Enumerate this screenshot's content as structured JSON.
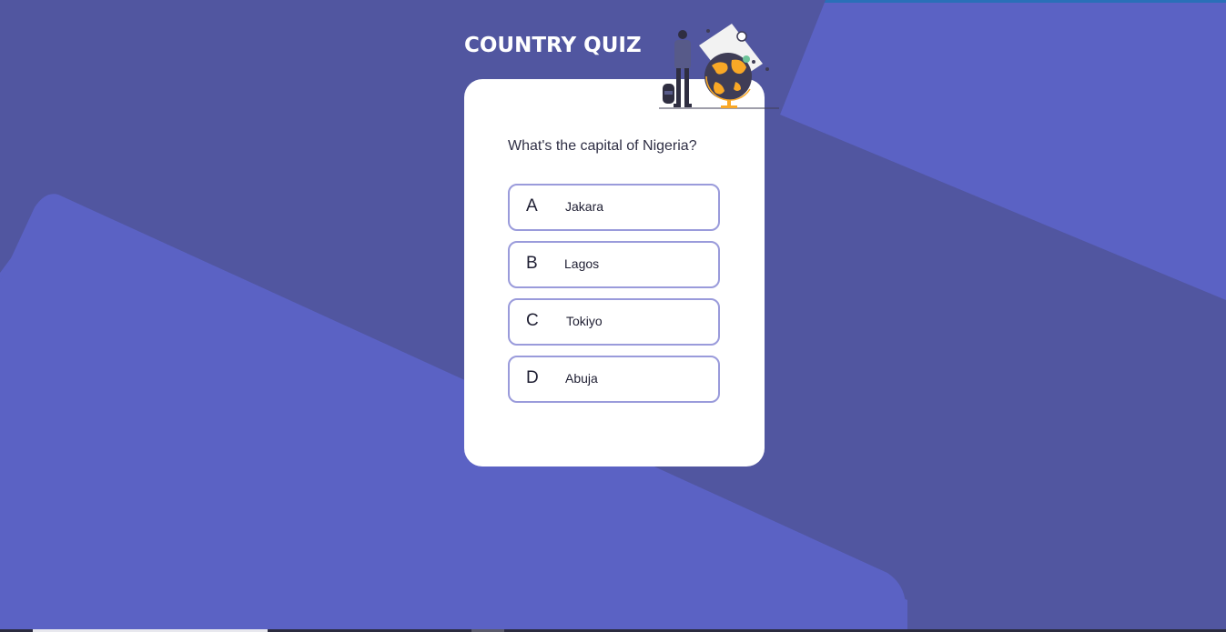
{
  "app": {
    "title": "COUNTRY QUIZ"
  },
  "quiz": {
    "question": "What's the capital of Nigeria?",
    "options": [
      {
        "letter": "A",
        "text": "Jakara"
      },
      {
        "letter": "B",
        "text": "Lagos"
      },
      {
        "letter": "C",
        "text": "Tokiyo"
      },
      {
        "letter": "D",
        "text": "Abuja"
      }
    ]
  },
  "colors": {
    "background": "#5b62c4",
    "background_shape": "#5156a0",
    "card": "#ffffff",
    "option_border": "#9a9bdb",
    "globe_accent": "#f9a826"
  },
  "icons": {
    "illustration": "traveler-with-globe-illustration"
  }
}
